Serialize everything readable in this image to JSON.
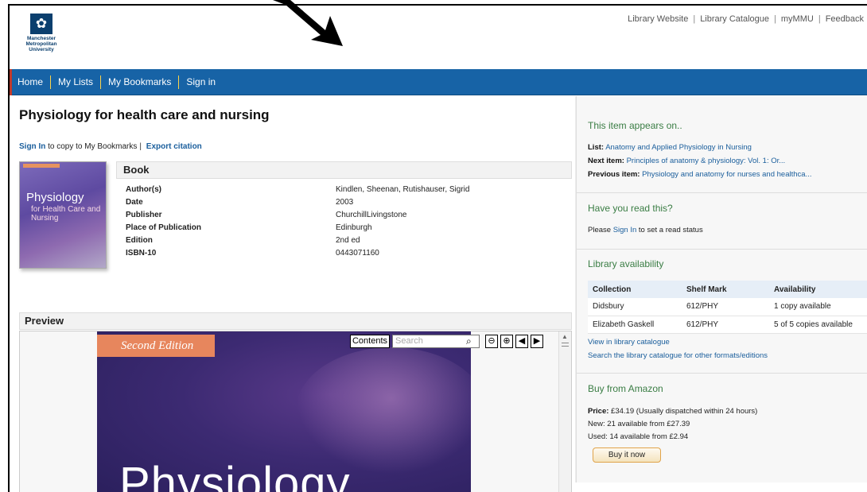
{
  "header": {
    "logo_lines": [
      "Manchester",
      "Metropolitan",
      "University"
    ],
    "top_links": [
      "Library Website",
      "Library Catalogue",
      "myMMU",
      "Feedback"
    ]
  },
  "nav": {
    "items": [
      "Home",
      "My Lists",
      "My Bookmarks",
      "Sign in"
    ]
  },
  "page": {
    "title": "Physiology for health care and nursing",
    "sign_in": "Sign In",
    "copy_text": "to copy to My Bookmarks",
    "export_citation": "Export citation"
  },
  "cover_thumb": {
    "title": "Physiology",
    "subtitle": "for Health Care and Nursing"
  },
  "book": {
    "heading": "Book",
    "rows": [
      {
        "key": "Author(s)",
        "value": "Kindlen, Sheenan, Rutishauser, Sigrid"
      },
      {
        "key": "Date",
        "value": "2003"
      },
      {
        "key": "Publisher",
        "value": "ChurchillLivingstone"
      },
      {
        "key": "Place of Publication",
        "value": "Edinburgh"
      },
      {
        "key": "Edition",
        "value": "2nd ed"
      },
      {
        "key": "ISBN-10",
        "value": "0443071160"
      }
    ]
  },
  "preview": {
    "heading": "Preview",
    "edition_band": "Second Edition",
    "big_title": "Physiology",
    "contents_label": "Contents",
    "search_placeholder": "Search"
  },
  "side": {
    "appears_title": "This item appears on..",
    "list_label": "List:",
    "list_value": "Anatomy and Applied Physiology in Nursing",
    "next_label": "Next item:",
    "next_value": "Principles of anatomy & physiology: Vol. 1: Or...",
    "prev_label": "Previous item:",
    "prev_value": "Physiology and anatomy for nurses and healthca...",
    "read_title": "Have you read this?",
    "read_prefix": "Please",
    "read_link": "Sign In",
    "read_suffix": "to set a read status",
    "avail_title": "Library availability",
    "avail_headers": [
      "Collection",
      "Shelf Mark",
      "Availability"
    ],
    "avail_rows": [
      [
        "Didsbury",
        "612/PHY",
        "1 copy available"
      ],
      [
        "Elizabeth Gaskell",
        "612/PHY",
        "5 of 5 copies available"
      ]
    ],
    "view_catalogue": "View in library catalogue",
    "search_catalogue": "Search the library catalogue for other formats/editions",
    "amazon_title": "Buy from Amazon",
    "price_label": "Price:",
    "price_value": "£34.19 (Usually dispatched within 24 hours)",
    "new_text": "New: 21 available from £27.39",
    "used_text": "Used: 14 available from £2.94",
    "buy_button": "Buy it now"
  }
}
